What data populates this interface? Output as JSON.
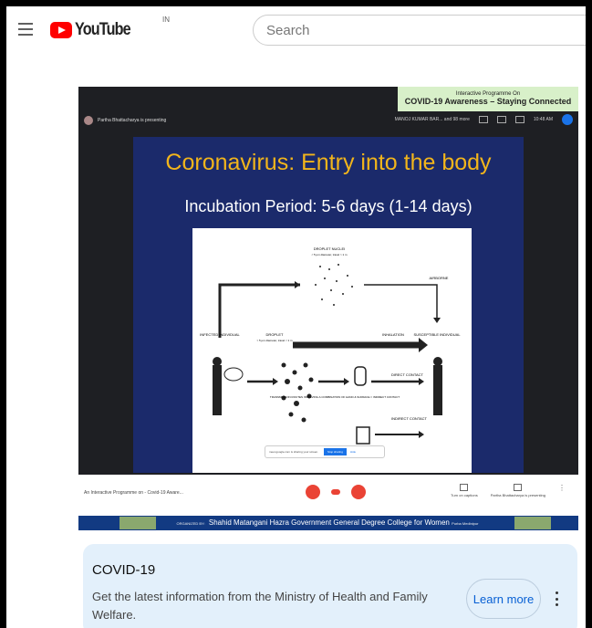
{
  "header": {
    "logo_text": "YouTube",
    "country_code": "IN",
    "search_placeholder": "Search"
  },
  "video": {
    "banner_line1": "Interactive Programme On",
    "banner_line2": "COVID-19 Awareness – Staying Connected",
    "presenter_text": "Partha Bhattacharya is presenting",
    "participant_text": "MANOJ KUMAR BAR... and 98 more",
    "time": "10:48 AM",
    "slide_title": "Coronavirus: Entry into the body",
    "slide_subtitle": "Incubation Period: 5-6 days (1-14 days)",
    "diagram": {
      "droplet_nuclei": "DROPLET NUCLEI",
      "droplet_nuclei_size": "< 5 µm diameter, travel > 1 m",
      "airborne": "AIRBORNE",
      "infected": "INFECTED INDIVIDUAL",
      "droplet": "DROPLET",
      "droplet_size": "> 5 µm diameter, travel < 1 m",
      "inhalation": "INHALATION",
      "susceptible": "SUSCEPTIBLE INDIVIDUAL",
      "direct_contact": "DIRECT CONTACT",
      "transmission": "TRANSMISSION ROUTES INVOLVING A COMBINATION OF HAND & SURFACE = INDIRECT CONTACT",
      "indirect_contact": "INDIRECT CONTACT"
    },
    "share_text": "meet.google.com is sharing your screen.",
    "stop_sharing": "Stop sharing",
    "hide": "Hide",
    "meeting_name": "An Interactive Programme on - Covid-19 Aware...",
    "captions_label": "Turn on captions",
    "presenting_label": "Partha Bhattacharya is presenting",
    "organized_by": "ORGANIZED BY:",
    "college": "Shahid Matangani Hazra Government General Degree College for Women",
    "college_place": "Purba Medinipur"
  },
  "info_card": {
    "title": "COVID-19",
    "body": "Get the latest information from the Ministry of Health and Family Welfare.",
    "button": "Learn more"
  }
}
